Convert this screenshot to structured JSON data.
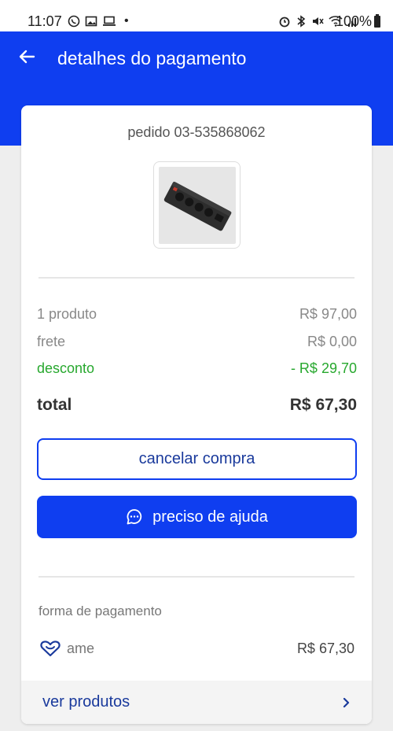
{
  "status_bar": {
    "time": "11:07",
    "dot": "•",
    "battery": "100%"
  },
  "header": {
    "title": "detalhes do pagamento"
  },
  "order": {
    "number": "pedido 03-535868062"
  },
  "summary": {
    "products_label": "1 produto",
    "products_value": "R$ 97,00",
    "shipping_label": "frete",
    "shipping_value": "R$ 0,00",
    "discount_label": "desconto",
    "discount_value": "- R$ 29,70",
    "total_label": "total",
    "total_value": "R$ 67,30"
  },
  "actions": {
    "cancel_label": "cancelar compra",
    "help_label": "preciso de ajuda"
  },
  "payment": {
    "heading": "forma de pagamento",
    "method": "ame",
    "amount": "R$ 67,30"
  },
  "footer": {
    "view_products_label": "ver produtos"
  },
  "colors": {
    "primary": "#0f3ef0",
    "discount": "#27a82e"
  }
}
